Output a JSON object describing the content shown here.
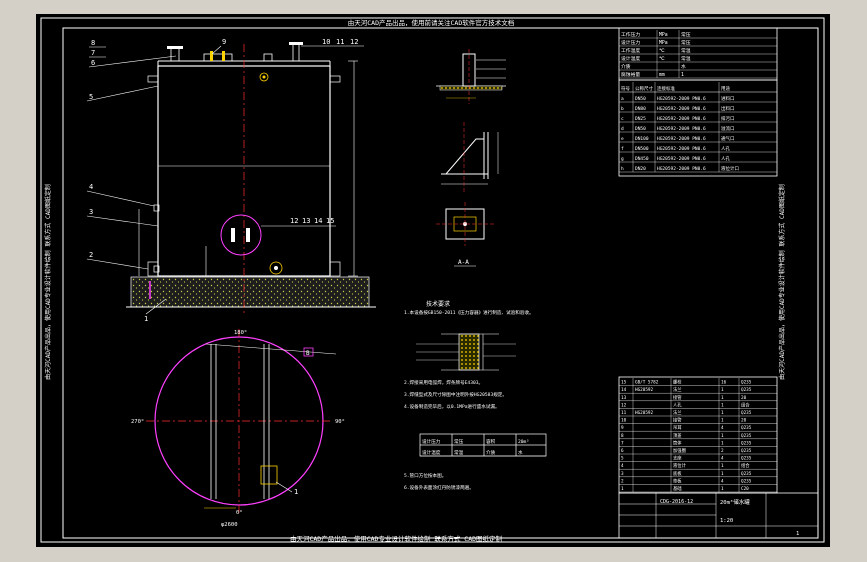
{
  "window": {
    "bg": "#d4d0c8",
    "canvas_bg": "#000000"
  },
  "drawing": {
    "top_banner": "由天河CAD产品出品，使用前请关注CAD软件官方技术文档",
    "bottom_banner": "由天河CAD产品出品，使用CAD专业设计软件绘制 联系方式 CAD图纸定制",
    "left_banner": "由天河CAD产品出品，使用CAD专业设计软件绘制 联系方式 CAD图纸定制",
    "right_banner": "由天河CAD产品出品，使用CAD专业设计软件绘制 联系方式 CAD图纸定制",
    "callouts_top": [
      "8",
      "7",
      "6",
      "9",
      "10",
      "11",
      "12"
    ],
    "callouts_left": [
      "5",
      "4",
      "3",
      "2",
      "1"
    ],
    "callouts_mid": [
      "12",
      "13",
      "14",
      "15"
    ],
    "callout_plan": "1",
    "plan_angles": [
      "0°",
      "90°",
      "180°",
      "270°"
    ],
    "tank_label": "φ2600",
    "section_mark": "A-A",
    "detail_mark": "B",
    "notes_title": "技术要求",
    "notes": [
      "1.本设备按GB150-2011《压力容器》进行制造、试验和验收。",
      "2.焊接采用电弧焊，焊条牌号E4303。",
      "3.焊缝型式及尺寸除图中注明外按HG20583规定。",
      "4.设备制造完毕后，以0.1MPa进行盛水试漏。",
      "5.管口方位按本图。",
      "6.设备外表面涂红丹防锈漆两遍。"
    ],
    "spec_rows": [
      [
        "设计压力",
        "常压",
        "容积",
        "20m³"
      ],
      [
        "设计温度",
        "常温",
        "介质",
        "水"
      ]
    ],
    "nozzle_table_header": [
      "符号",
      "公称尺寸",
      "连接标准",
      "用途"
    ],
    "nozzle_rows": [
      [
        "a",
        "DN50",
        "HG20592-2009 PN0.6",
        "进料口"
      ],
      [
        "b",
        "DN80",
        "HG20592-2009 PN0.6",
        "出料口"
      ],
      [
        "c",
        "DN25",
        "HG20592-2009 PN0.6",
        "排污口"
      ],
      [
        "d",
        "DN50",
        "HG20592-2009 PN0.6",
        "溢流口"
      ],
      [
        "e",
        "DN100",
        "HG20592-2009 PN0.6",
        "通气口"
      ],
      [
        "f",
        "DN500",
        "HG20592-2009 PN0.6",
        "人孔"
      ],
      [
        "g",
        "DN450",
        "HG20592-2009 PN0.6",
        "人孔"
      ],
      [
        "h",
        "DN20",
        "HG20592-2009 PN0.6",
        "液位计口"
      ]
    ],
    "design_rows": [
      [
        "工作压力",
        "MPa",
        "常压"
      ],
      [
        "设计压力",
        "MPa",
        "常压"
      ],
      [
        "工作温度",
        "℃",
        "常温"
      ],
      [
        "设计温度",
        "℃",
        "常温"
      ],
      [
        "介质",
        "",
        "水"
      ],
      [
        "腐蚀裕量",
        "mm",
        "1"
      ]
    ],
    "parts_rows": [
      [
        "15",
        "GB/T 5782",
        "螺栓",
        "16",
        "Q235"
      ],
      [
        "14",
        "HG20592",
        "法兰",
        "1",
        "Q235"
      ],
      [
        "13",
        "",
        "接管",
        "1",
        "20"
      ],
      [
        "12",
        "",
        "人孔",
        "1",
        "组合"
      ],
      [
        "11",
        "HG20592",
        "法兰",
        "1",
        "Q235"
      ],
      [
        "10",
        "",
        "接管",
        "1",
        "20"
      ],
      [
        "9",
        "",
        "吊耳",
        "4",
        "Q235"
      ],
      [
        "8",
        "",
        "顶盖",
        "1",
        "Q235"
      ],
      [
        "7",
        "",
        "筒体",
        "1",
        "Q235"
      ],
      [
        "6",
        "",
        "加强圈",
        "2",
        "Q235"
      ],
      [
        "5",
        "",
        "支座",
        "4",
        "Q235"
      ],
      [
        "4",
        "",
        "液位计",
        "1",
        "组合"
      ],
      [
        "3",
        "",
        "底板",
        "1",
        "Q235"
      ],
      [
        "2",
        "",
        "垫板",
        "4",
        "Q235"
      ],
      [
        "1",
        "",
        "基础",
        "1",
        "C20"
      ]
    ],
    "title_block": {
      "name": "20m³储水罐",
      "drawing_no": "CDG-2016-12",
      "scale": "1:20",
      "sheet": "1"
    }
  }
}
